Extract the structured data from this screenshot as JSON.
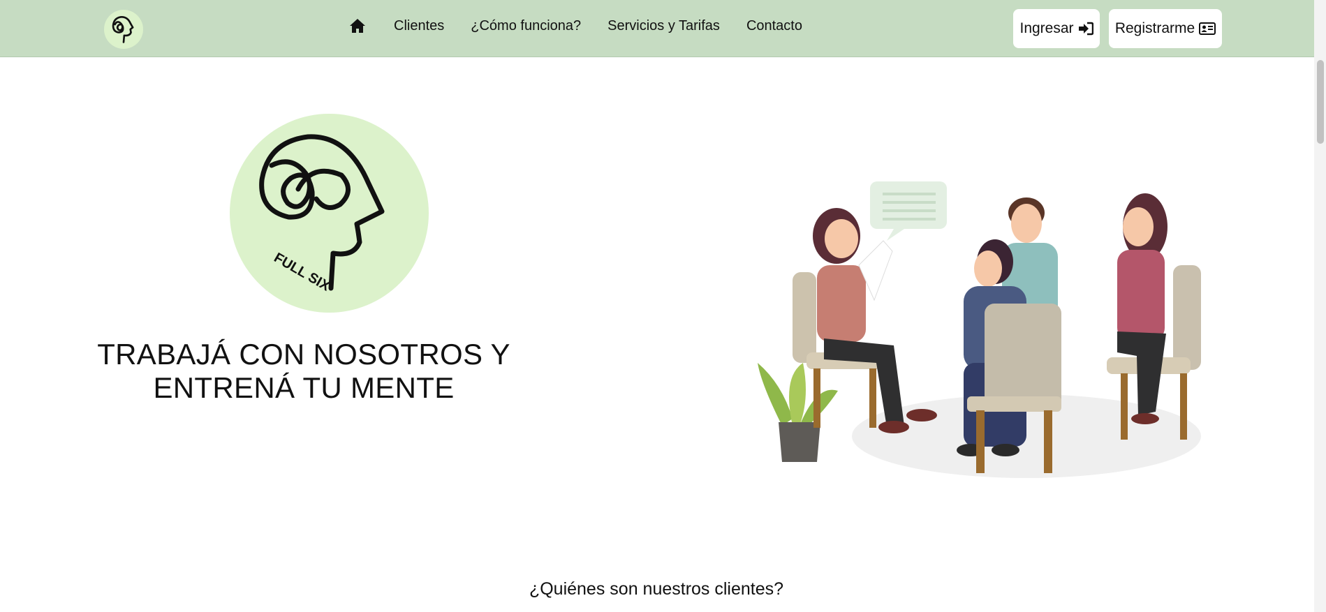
{
  "navbar": {
    "brand_logo": "full-six-head-logo",
    "home_icon": "home-icon",
    "links": [
      "Clientes",
      "¿Cómo funciona?",
      "Servicios y Tarifas",
      "Contacto"
    ],
    "login_label": "Ingresar",
    "login_icon": "sign-in-icon",
    "register_label": "Registrarme",
    "register_icon": "id-card-icon"
  },
  "hero": {
    "logo_text": "FULL SIX",
    "title": "TRABAJÁ CON NOSOTROS Y ENTRENÁ TU MENTE",
    "illustration": "group-therapy-illustration"
  },
  "clients_section": {
    "title": "¿Quiénes son nuestros clientes?"
  },
  "colors": {
    "navbar_bg": "#c6dcc2",
    "logo_bg": "#dcf2cb",
    "button_bg": "#ffffff"
  }
}
